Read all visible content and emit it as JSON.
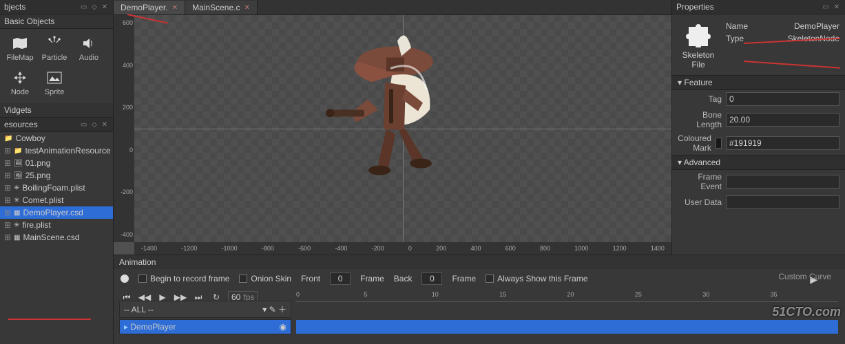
{
  "left": {
    "objects_title": "bjects",
    "basic_title": "Basic Objects",
    "items": [
      {
        "label": "FileMap"
      },
      {
        "label": "Particle"
      },
      {
        "label": "Audio"
      },
      {
        "label": "Node"
      },
      {
        "label": "Sprite"
      }
    ],
    "widgets_title": "Vidgets",
    "resources_title": "esources",
    "resources": [
      {
        "label": "Cowboy",
        "root": true,
        "icon": "folder"
      },
      {
        "label": "testAnimationResource",
        "icon": "folder"
      },
      {
        "label": "01.png",
        "icon": "img"
      },
      {
        "label": "25.png",
        "icon": "img"
      },
      {
        "label": "BoilingFoam.plist",
        "icon": "plist"
      },
      {
        "label": "Comet.plist",
        "icon": "plist"
      },
      {
        "label": "DemoPlayer.csd",
        "icon": "csd",
        "sel": true
      },
      {
        "label": "fire.plist",
        "icon": "plist"
      },
      {
        "label": "MainScene.csd",
        "icon": "csd"
      }
    ]
  },
  "tabs": [
    {
      "label": "DemoPlayer.",
      "active": true
    },
    {
      "label": "MainScene.c",
      "active": false
    }
  ],
  "ruler_v": [
    "600",
    "400",
    "200",
    "0",
    "-200",
    "-400"
  ],
  "ruler_h": [
    "-1400",
    "-1200",
    "-1000",
    "-800",
    "-600",
    "-400",
    "-200",
    "0",
    "200",
    "400",
    "600",
    "800",
    "1000",
    "1200",
    "1400"
  ],
  "anim": {
    "title": "Animation",
    "begin_record": "Begin to record frame",
    "onion": "Onion Skin",
    "front": "Front",
    "front_v": "0",
    "frame1": "Frame",
    "back": "Back",
    "back_v": "0",
    "frame2": "Frame",
    "always": "Always Show this Frame",
    "fps": "60",
    "fps_lbl": "fps",
    "all": "-- ALL --",
    "track": "DemoPlayer",
    "ticks": [
      "0",
      "5",
      "10",
      "15",
      "20",
      "25",
      "30",
      "35"
    ],
    "custom_curve": "Custom Curve"
  },
  "props": {
    "title": "Properties",
    "skeleton_file": "Skeleton File",
    "name_lbl": "Name",
    "name_val": "DemoPlayer",
    "type_lbl": "Type",
    "type_val": "SkeletonNode",
    "feature": "Feature",
    "tag_lbl": "Tag",
    "tag_val": "0",
    "bone_lbl": "Bone Length",
    "bone_val": "20.00",
    "color_lbl": "Coloured Mark",
    "color_val": "#191919",
    "advanced": "Advanced",
    "frame_event": "Frame Event",
    "frame_event_val": "",
    "user_data": "User Data",
    "user_data_val": ""
  },
  "watermark": "51CTO.com"
}
